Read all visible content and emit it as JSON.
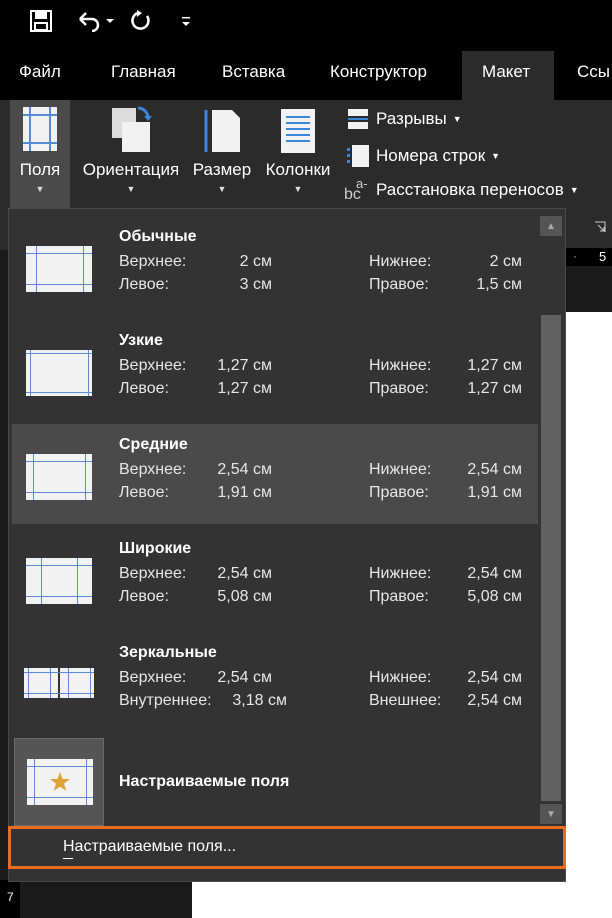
{
  "quick_access": {
    "save_icon": "save-icon",
    "undo_icon": "undo-icon",
    "redo_icon": "repeat-icon",
    "customize_icon": "customize-qat-icon"
  },
  "tabs": [
    {
      "label": "Файл"
    },
    {
      "label": "Главная"
    },
    {
      "label": "Вставка"
    },
    {
      "label": "Конструктор"
    },
    {
      "label": "Макет",
      "active": true
    },
    {
      "label": "Ссы"
    }
  ],
  "ribbon": {
    "margins_label": "Поля",
    "orientation_label": "Ориентация",
    "size_label": "Размер",
    "columns_label": "Колонки",
    "breaks_label": "Разрывы",
    "line_numbers_label": "Номера строк",
    "hyphenation_label": "Расстановка переносов",
    "hyphenation_icon_text": "bc",
    "hyphenation_icon_sup": "a-"
  },
  "ruler": {
    "number": "5"
  },
  "vruler_number": "7",
  "margins_menu": {
    "items": [
      {
        "name": "Обычные",
        "l1": "Верхнее:",
        "v1": "2 см",
        "l2": "Нижнее:",
        "v2": "2 см",
        "l3": "Левое:",
        "v3": "3 см",
        "l4": "Правое:",
        "v4": "1,5 см"
      },
      {
        "name": "Узкие",
        "l1": "Верхнее:",
        "v1": "1,27 см",
        "l2": "Нижнее:",
        "v2": "1,27 см",
        "l3": "Левое:",
        "v3": "1,27 см",
        "l4": "Правое:",
        "v4": "1,27 см"
      },
      {
        "name": "Средние",
        "l1": "Верхнее:",
        "v1": "2,54 см",
        "l2": "Нижнее:",
        "v2": "2,54 см",
        "l3": "Левое:",
        "v3": "1,91 см",
        "l4": "Правое:",
        "v4": "1,91 см"
      },
      {
        "name": "Широкие",
        "l1": "Верхнее:",
        "v1": "2,54 см",
        "l2": "Нижнее:",
        "v2": "2,54 см",
        "l3": "Левое:",
        "v3": "5,08 см",
        "l4": "Правое:",
        "v4": "5,08 см"
      },
      {
        "name": "Зеркальные",
        "l1": "Верхнее:",
        "v1": "2,54 см",
        "l2": "Нижнее:",
        "v2": "2,54 см",
        "l3": "Внутреннее:",
        "v3": "3,18 см",
        "l4": "Внешнее:",
        "v4": "2,54 см"
      }
    ],
    "custom_last_label": "Настраиваемые поля",
    "custom_command": "Настраиваемые поля..."
  },
  "colors": {
    "accent_highlight": "#e86d1f",
    "margin_line": "#5b8bd6",
    "star": "#e0a23a"
  }
}
